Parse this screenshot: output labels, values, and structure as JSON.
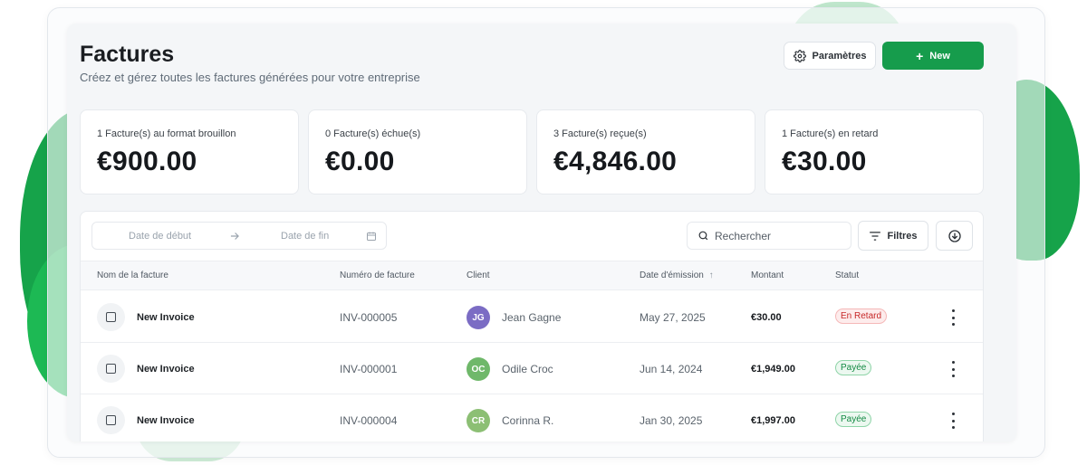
{
  "header": {
    "title": "Factures",
    "subtitle": "Créez et gérez toutes les factures générées pour votre entreprise",
    "settings_label": "Paramètres",
    "new_label": "New",
    "new_icon": "plus-icon",
    "settings_icon": "gear-icon"
  },
  "stats": [
    {
      "label": "1 Facture(s) au format brouillon",
      "amount": "€900.00"
    },
    {
      "label": "0 Facture(s) échue(s)",
      "amount": "€0.00"
    },
    {
      "label": "3 Facture(s) reçue(s)",
      "amount": "€4,846.00"
    },
    {
      "label": "1 Facture(s) en retard",
      "amount": "€30.00"
    }
  ],
  "toolbar": {
    "date_start_placeholder": "Date de début",
    "date_end_placeholder": "Date de fin",
    "search_placeholder": "Rechercher",
    "filters_label": "Filtres",
    "download_icon": "download-icon"
  },
  "table": {
    "columns": [
      "Nom de la facture",
      "Numéro de facture",
      "Client",
      "Date d'émission",
      "Montant",
      "Statut"
    ],
    "sort_indicator": "↑",
    "rows": [
      {
        "name": "New Invoice",
        "number": "INV-000005",
        "initials": "JG",
        "avatar_color": "#7b6cc4",
        "client": "Jean Gagne",
        "date": "May 27, 2025",
        "amount": "€30.00",
        "status": "En Retard",
        "status_type": "late"
      },
      {
        "name": "New Invoice",
        "number": "INV-000001",
        "initials": "OC",
        "avatar_color": "#6fb86a",
        "client": "Odile Croc",
        "date": "Jun 14, 2024",
        "amount": "€1,949.00",
        "status": "Payée",
        "status_type": "paid"
      },
      {
        "name": "New Invoice",
        "number": "INV-000004",
        "initials": "CR",
        "avatar_color": "#8cbf74",
        "client": "Corinna R.",
        "date": "Jan 30, 2025",
        "amount": "€1,997.00",
        "status": "Payée",
        "status_type": "paid"
      }
    ]
  },
  "colors": {
    "accent": "#169c4c",
    "late": "#c62828",
    "paid": "#138a43"
  }
}
